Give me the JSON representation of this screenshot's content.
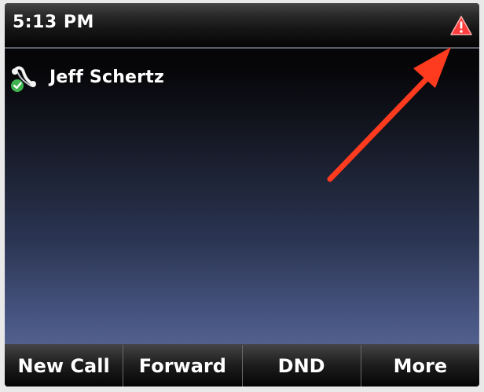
{
  "status_bar": {
    "time": "5:13 PM",
    "warning_icon": "warning-triangle-icon",
    "warning_color": "#ff3b3b"
  },
  "line": {
    "name": "Jeff Schertz",
    "icon": "registered-line-icon",
    "registration_color": "#3fb34f"
  },
  "annotation": {
    "icon": "red-arrow-icon",
    "color": "#ff3b1f"
  },
  "softkeys": [
    {
      "label": "New Call"
    },
    {
      "label": "Forward"
    },
    {
      "label": "DND"
    },
    {
      "label": "More"
    }
  ],
  "colors": {
    "status_bar_top": "#464646",
    "status_bar_bottom": "#050505",
    "screen_bottom": "#64719f"
  }
}
